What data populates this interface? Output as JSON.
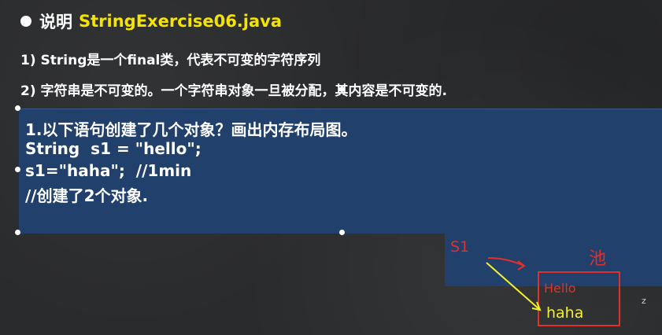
{
  "heading": {
    "label": "说明",
    "title": "StringExercise06.java"
  },
  "points": [
    "1) String是一个final类，代表不可变的字符序列",
    "2) 字符串是不可变的。一个字符串对象一旦被分配，其内容是不可变的."
  ],
  "textbox": {
    "lines": [
      "1.以下语句创建了几个对象？画出内存布局图。",
      "String  s1 = \"hello\";",
      "s1=\"haha\";  //1min",
      "//创建了2个对象."
    ]
  },
  "annotation": {
    "label_s1": "S1",
    "label_right": "池",
    "value_old": "Hello",
    "value_new": "haha",
    "color_red": "#e0312c",
    "color_yellow": "#f2ef2c"
  },
  "ui": {
    "corner_mark": "z"
  }
}
